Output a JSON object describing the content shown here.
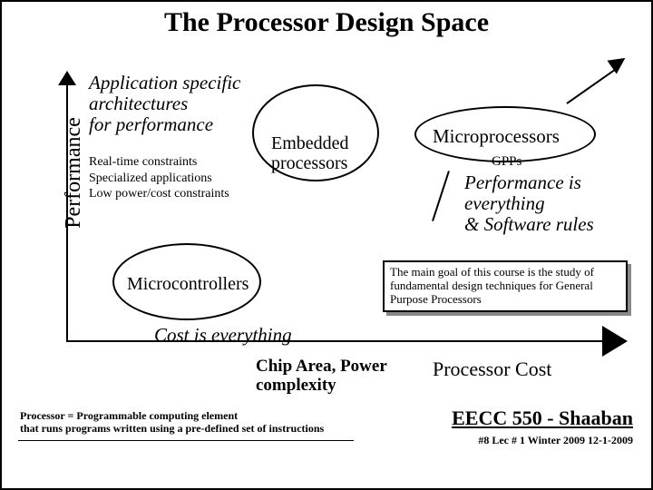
{
  "title": "The Processor Design Space",
  "y_axis": {
    "label": "Performance"
  },
  "x_axis": {
    "left_label": "Chip Area, Power\ncomplexity",
    "right_label": "Processor Cost"
  },
  "app_specific": {
    "line1": "Application specific",
    "line2": "architectures",
    "line3": "for performance"
  },
  "embedded": {
    "line1": "Embedded",
    "line2": "processors"
  },
  "constraints": {
    "line1": "Real-time constraints",
    "line2": "Specialized applications",
    "line3": "Low power/cost constraints"
  },
  "microcontrollers": "Microcontrollers",
  "cost_everything": "Cost is everything",
  "microprocessors": "Microprocessors",
  "gpps": "GPPs",
  "perf_text": {
    "line1": "Performance is",
    "line2": "everything",
    "line3": "& Software rules"
  },
  "goal_box": "The main goal of this course is the study of fundamental design techniques for General Purpose Processors",
  "proc_def": {
    "line1": "Processor =  Programmable computing element",
    "line2": "that runs programs written using a pre-defined set of instructions"
  },
  "course_id": "EECC 550 - Shaaban",
  "lecture_info": "#8   Lec # 1  Winter 2009  12-1-2009"
}
